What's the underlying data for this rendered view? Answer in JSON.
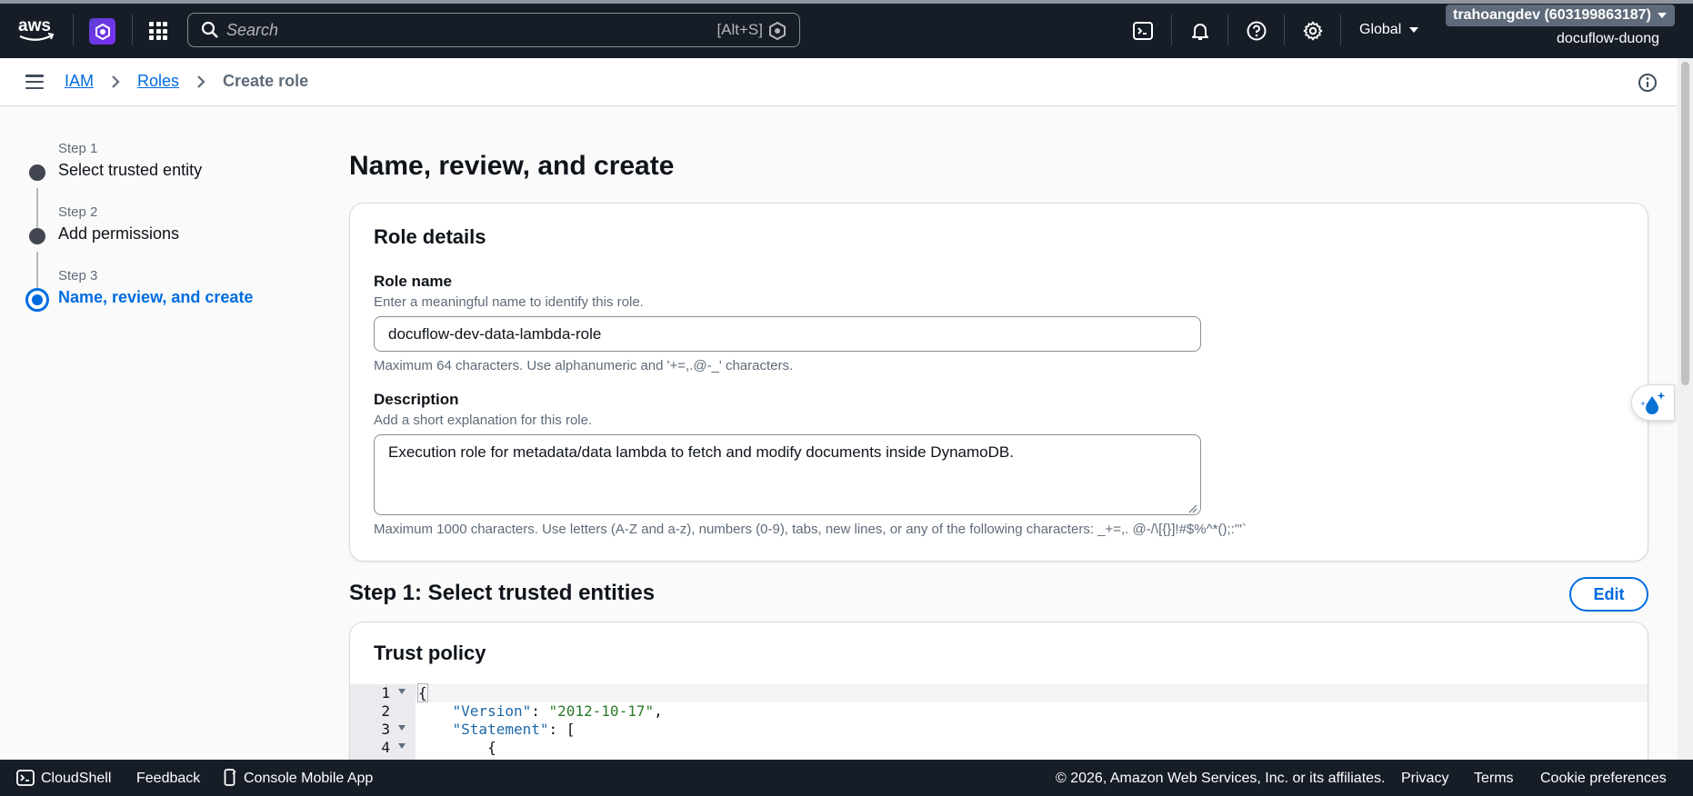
{
  "topnav": {
    "search_placeholder": "Search",
    "search_shortcut": "[Alt+S]",
    "region": "Global",
    "account_name": "trahoangdev (603199863187)",
    "account_alias": "docuflow-duong"
  },
  "breadcrumb": {
    "items": [
      "IAM",
      "Roles"
    ],
    "current": "Create role"
  },
  "steps": [
    {
      "label": "Step 1",
      "title": "Select trusted entity",
      "state": "complete"
    },
    {
      "label": "Step 2",
      "title": "Add permissions",
      "state": "complete"
    },
    {
      "label": "Step 3",
      "title": "Name, review, and create",
      "state": "active"
    }
  ],
  "page_title": "Name, review, and create",
  "role_details": {
    "title": "Role details",
    "role_name": {
      "label": "Role name",
      "description": "Enter a meaningful name to identify this role.",
      "value": "docuflow-dev-data-lambda-role",
      "constraint": "Maximum 64 characters. Use alphanumeric and '+=,.@-_' characters."
    },
    "description": {
      "label": "Description",
      "description": "Add a short explanation for this role.",
      "value": "Execution role for metadata/data lambda to fetch and modify documents inside DynamoDB.",
      "constraint": "Maximum 1000 characters. Use letters (A-Z and a-z), numbers (0-9), tabs, new lines, or any of the following characters: _+=,. @-/\\[{}]!#$%^*();:\"'`"
    }
  },
  "step1_section": {
    "title": "Step 1: Select trusted entities",
    "edit_label": "Edit"
  },
  "trust_policy": {
    "title": "Trust policy",
    "lines": [
      {
        "num": "1",
        "fold": true,
        "key": "",
        "sep": "",
        "str": "",
        "tail": "{",
        "indent": ""
      },
      {
        "num": "2",
        "fold": false,
        "key": "\"Version\"",
        "sep": ": ",
        "str": "\"2012-10-17\"",
        "tail": ",",
        "indent": "    "
      },
      {
        "num": "3",
        "fold": true,
        "key": "\"Statement\"",
        "sep": ": ",
        "str": "",
        "tail": "[",
        "indent": "    "
      },
      {
        "num": "4",
        "fold": true,
        "key": "",
        "sep": "",
        "str": "",
        "tail": "{",
        "indent": "        "
      }
    ]
  },
  "footer": {
    "cloudshell": "CloudShell",
    "feedback": "Feedback",
    "mobile_app": "Console Mobile App",
    "copyright": "© 2026, Amazon Web Services, Inc. or its affiliates.",
    "privacy": "Privacy",
    "terms": "Terms",
    "cookies": "Cookie preferences"
  },
  "colors": {
    "nav_bg": "#161d26",
    "link_blue": "#006ce0",
    "active_step": "#006ce0"
  }
}
